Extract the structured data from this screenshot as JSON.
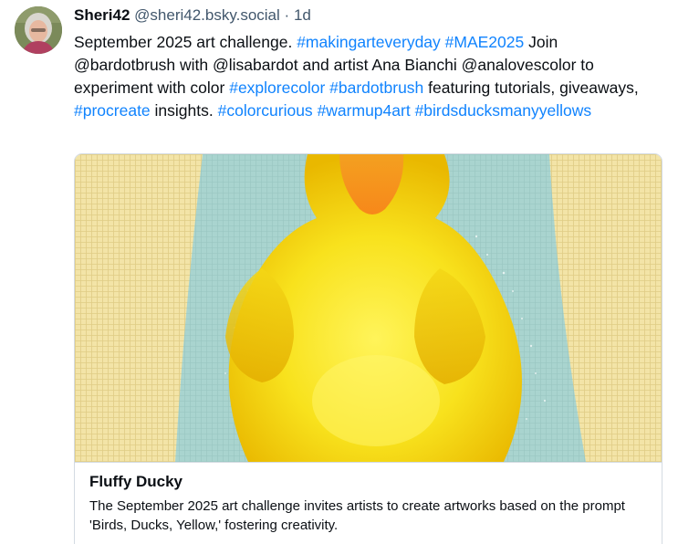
{
  "author": {
    "display_name": "Sheri42",
    "handle": "@sheri42.bsky.social",
    "separator": "·",
    "time": "1d"
  },
  "post": {
    "segments": [
      {
        "type": "text",
        "value": "September 2025 art challenge. "
      },
      {
        "type": "tag",
        "value": "#makingarteveryday"
      },
      {
        "type": "text",
        "value": " "
      },
      {
        "type": "tag",
        "value": "#MAE2025"
      },
      {
        "type": "text",
        "value": " Join @bardotbrush with @lisabardot and artist Ana Bianchi @analovescolor to experiment with color "
      },
      {
        "type": "tag",
        "value": "#explorecolor"
      },
      {
        "type": "text",
        "value": " "
      },
      {
        "type": "tag",
        "value": "#bardotbrush"
      },
      {
        "type": "text",
        "value": " featuring tutorials, giveaways, "
      },
      {
        "type": "tag",
        "value": "#procreate"
      },
      {
        "type": "text",
        "value": " insights. "
      },
      {
        "type": "tag",
        "value": "#colorcurious"
      },
      {
        "type": "text",
        "value": " "
      },
      {
        "type": "tag",
        "value": "#warmup4art"
      },
      {
        "type": "text",
        "value": " "
      },
      {
        "type": "tag",
        "value": "#birdsducksmanyyellows"
      }
    ]
  },
  "link_card": {
    "title": "Fluffy Ducky",
    "description": "The September 2025 art challenge invites artists to create artworks based on the prompt 'Birds, Ducks, Yellow,' fostering creativity."
  },
  "colors": {
    "accent": "#1083fe",
    "text_primary": "#0b0f14",
    "text_secondary": "#42576c",
    "border": "#d4dbe2",
    "duck_yellow": "#f7e01a",
    "beak_orange": "#f7931e",
    "bg_teal": "#a9d4cf",
    "bg_cream": "#f3e4a7"
  },
  "icons": {
    "avatar": "user-avatar-photo"
  }
}
